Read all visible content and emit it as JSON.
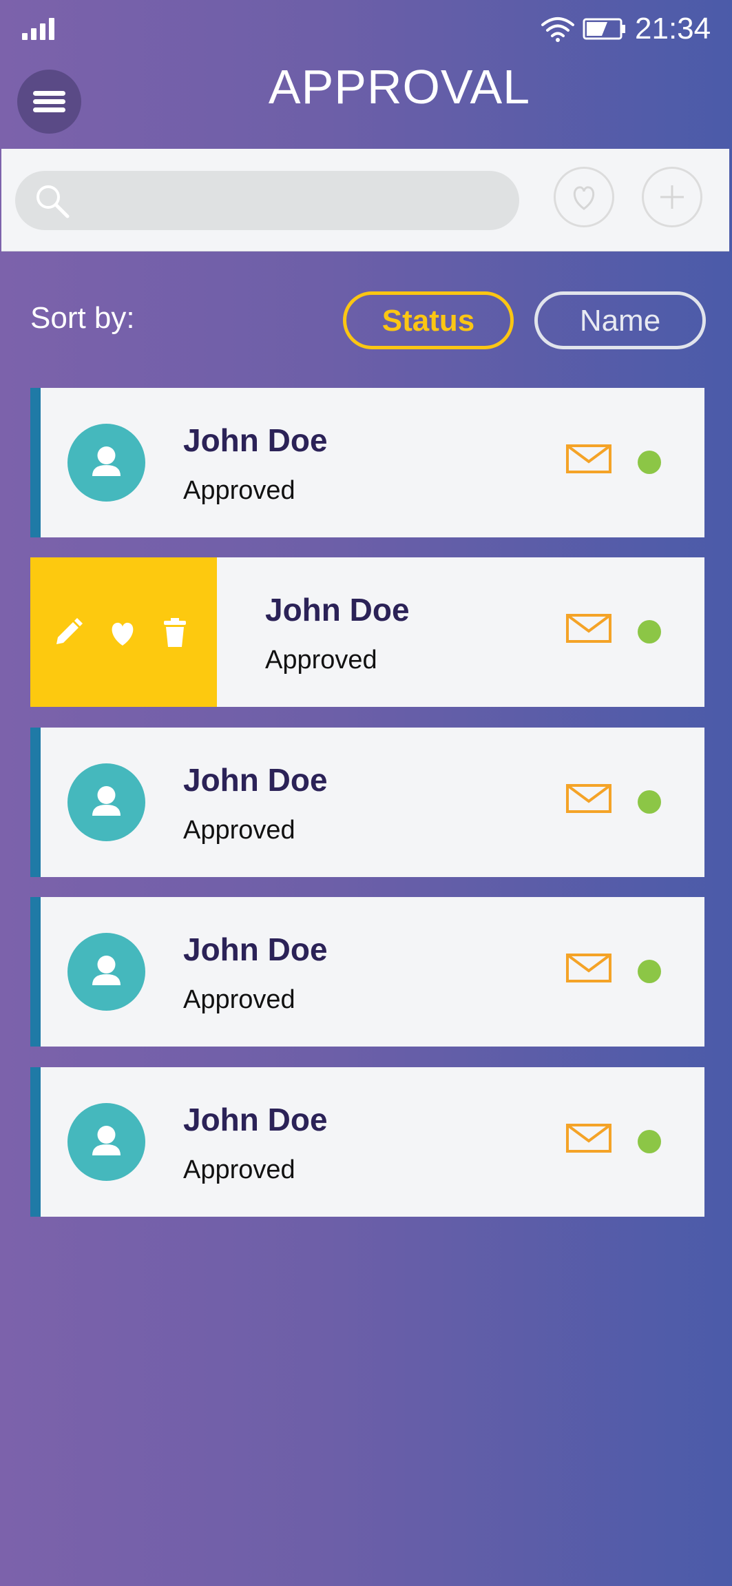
{
  "status_bar": {
    "time": "21:34",
    "icons": [
      "signal-icon",
      "wifi-icon",
      "battery-icon"
    ]
  },
  "header": {
    "title": "APPROVAL",
    "menu_icon": "hamburger-menu-icon"
  },
  "search": {
    "placeholder": "",
    "icon": "search-icon",
    "actions": [
      "heart-icon",
      "plus-icon"
    ]
  },
  "sort": {
    "label": "Sort by:",
    "options": [
      "Status",
      "Name"
    ],
    "selected": "Status"
  },
  "list": {
    "items": [
      {
        "name": "John Doe",
        "status": "Approved",
        "online": true,
        "swiped": false
      },
      {
        "name": "John Doe",
        "status": "Approved",
        "online": true,
        "swiped": true
      },
      {
        "name": "John Doe",
        "status": "Approved",
        "online": true,
        "swiped": false
      },
      {
        "name": "John Doe",
        "status": "Approved",
        "online": true,
        "swiped": false
      },
      {
        "name": "John Doe",
        "status": "Approved",
        "online": true,
        "swiped": false
      }
    ],
    "swipe_actions": [
      "pencil-icon",
      "heart-icon",
      "trash-icon"
    ]
  },
  "colors": {
    "accent": "#fbc613",
    "avatar": "#45b8bd",
    "name_text": "#2b2257",
    "mail": "#f4a327",
    "online_dot": "#8cc646",
    "card_accent": "#1f7aa6"
  }
}
